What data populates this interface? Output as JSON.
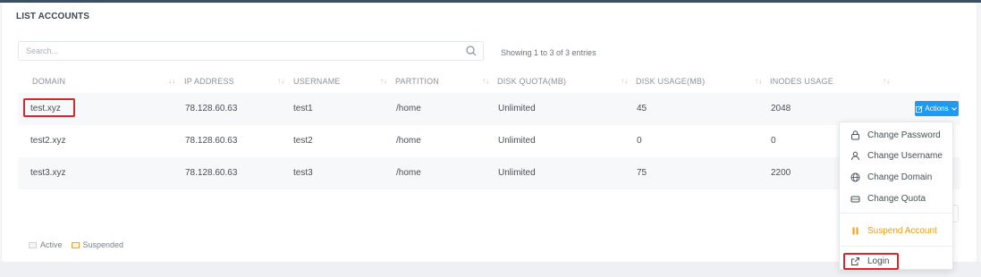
{
  "page": {
    "title": "LIST ACCOUNTS"
  },
  "search": {
    "placeholder": "Search...",
    "value": "",
    "icon": "search-icon"
  },
  "showing": "Showing 1 to 3 of 3 entries",
  "columns": [
    "DOMAIN",
    "IP ADDRESS",
    "USERNAME",
    "PARTITION",
    "DISK QUOTA(MB)",
    "DISK USAGE(MB)",
    "INODES USAGE",
    ""
  ],
  "rows": [
    {
      "domain": "test.xyz",
      "ip": "78.128.60.63",
      "username": "test1",
      "partition": "/home",
      "quota": "Unlimited",
      "usage": "45",
      "inodes": "2048"
    },
    {
      "domain": "test2.xyz",
      "ip": "78.128.60.63",
      "username": "test2",
      "partition": "/home",
      "quota": "Unlimited",
      "usage": "0",
      "inodes": "0"
    },
    {
      "domain": "test3.xyz",
      "ip": "78.128.60.63",
      "username": "test3",
      "partition": "/home",
      "quota": "Unlimited",
      "usage": "75",
      "inodes": "2200"
    }
  ],
  "actions": {
    "label": "Actions"
  },
  "menu": {
    "items": [
      {
        "label": "Change Password",
        "icon": "lock-icon"
      },
      {
        "label": "Change Username",
        "icon": "user-icon"
      },
      {
        "label": "Change Domain",
        "icon": "globe-icon"
      },
      {
        "label": "Change Quota",
        "icon": "storage-icon"
      },
      {
        "label": "Suspend Account",
        "icon": "pause-icon"
      },
      {
        "label": "Login",
        "icon": "external-link-icon"
      }
    ]
  },
  "legend": {
    "active": "Active",
    "suspended": "Suspended"
  },
  "colors": {
    "accent": "#1e9bf0",
    "highlight": "#d8262f",
    "suspend": "#f39c12",
    "topbar": "#3d4f63"
  }
}
